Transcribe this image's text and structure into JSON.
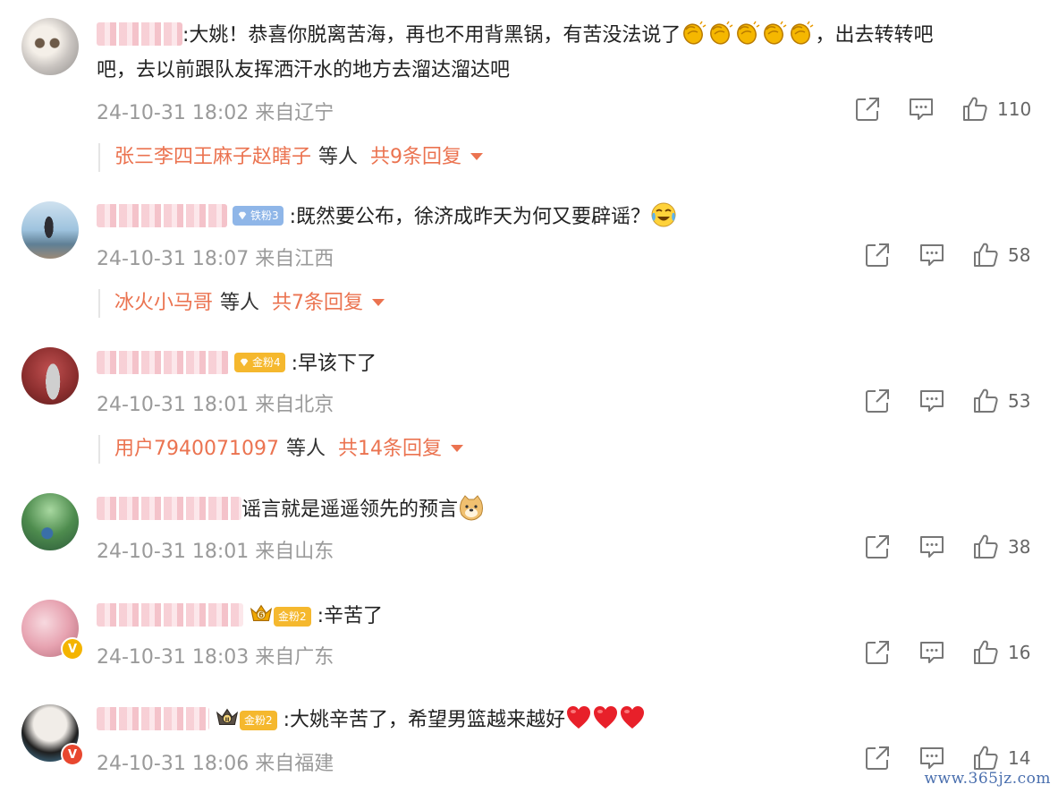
{
  "comments": [
    {
      "text_lines": [
        "大姚！恭喜你脱离苦海，再也不用背黑锅，有苦没法说了",
        "，出去转转吧",
        "吧，去以前跟队友挥洒汗水的地方去溜达溜达吧"
      ],
      "emoji": [
        "clapping-hands",
        "clapping-hands",
        "clapping-hands",
        "clapping-hands",
        "clapping-hands"
      ],
      "meta": "24-10-31 18:02 来自辽宁",
      "likes": "110",
      "replies": {
        "who": "张三李四王麻子赵瞎子",
        "etc": "等人",
        "count": "共9条回复"
      }
    },
    {
      "badge": "铁粉3",
      "text": "既然要公布，徐济成昨天为何又要辟谣？",
      "emoji": [
        "crying-laughing"
      ],
      "meta": "24-10-31 18:07 来自江西",
      "likes": "58",
      "replies": {
        "who": "冰火小马哥",
        "etc": "等人",
        "count": "共7条回复"
      }
    },
    {
      "badge": "金粉4",
      "text": "早该下了",
      "meta": "24-10-31 18:01 来自北京",
      "likes": "53",
      "replies": {
        "who": "用户7940071097",
        "etc": "等人",
        "count": "共14条回复"
      }
    },
    {
      "text": "谣言就是遥遥领先的预言",
      "emoji": [
        "doge"
      ],
      "meta": "24-10-31 18:01 来自山东",
      "likes": "38"
    },
    {
      "badge": "金粉2",
      "crown": "6",
      "text": "辛苦了",
      "meta": "24-10-31 18:03 来自广东",
      "likes": "16",
      "verify": "V"
    },
    {
      "badge": "金粉2",
      "crown": "II",
      "text": "大姚辛苦了，希望男篮越来越好",
      "emoji": [
        "red-heart",
        "red-heart",
        "red-heart"
      ],
      "meta": "24-10-31 18:06 来自福建",
      "likes": "14",
      "verify": "V"
    }
  ],
  "colors": {
    "accent": "#eb7350",
    "meta": "#9a9a9a",
    "iron_badge": "#8fb6e8",
    "gold_badge": "#f5b82e"
  },
  "icons": {
    "share": "share-icon",
    "comment": "comment-icon",
    "like": "thumbs-up-icon"
  },
  "watermark": "www.365jz.com"
}
